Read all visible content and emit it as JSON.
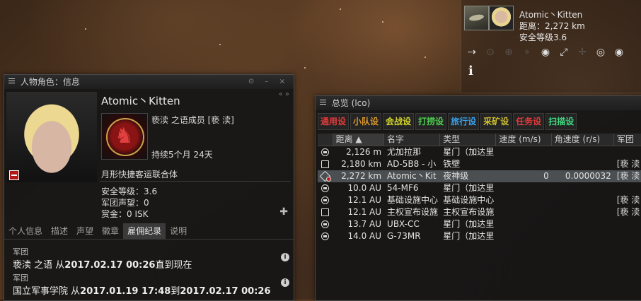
{
  "target": {
    "name": "Atomic丶Kitten",
    "distance": "距离：2,272 km",
    "security": "安全等级3.6",
    "info_glyph": "i",
    "action_icons": [
      "approach-icon",
      "orbit-icon",
      "keep-at-range-icon",
      "lock-icon",
      "warp-icon",
      "look-at-icon",
      "show-info-icon",
      "align-icon",
      "watch-icon"
    ]
  },
  "character_window": {
    "title": "人物角色：信息",
    "name": "Atomic丶Kitten",
    "corp_line": "亵渎 之语成员 [亵 渎]",
    "corp_duration": "持续5个月 24天",
    "alliance": "月形快捷客运联合体",
    "security": "安全等级：3.6",
    "faction_standing": "军团声望：0",
    "bounty": "赏金：0 ISK",
    "tabs": [
      "个人信息",
      "描述",
      "声望",
      "徽章",
      "雇佣纪录",
      "说明"
    ],
    "active_tab": "雇佣纪录",
    "history": [
      {
        "label": "军团",
        "corp": "亵渎 之语",
        "from_word": "从",
        "start": "2017.02.17 00:26",
        "to_word": "直到现在",
        "end": ""
      },
      {
        "label": "军团",
        "corp": "国立军事学院",
        "from_word": "从",
        "start": "2017.01.19 17:48",
        "to_word": "到",
        "end": "2017.02.17 00:26"
      }
    ]
  },
  "overview": {
    "title": "总览 (lco)",
    "presets": [
      {
        "label": "通用设",
        "color": "#e03a3a"
      },
      {
        "label": "小队设",
        "color": "#d8962a"
      },
      {
        "label": "会战设",
        "color": "#d6d62a"
      },
      {
        "label": "打捞设",
        "color": "#4fd04f"
      },
      {
        "label": "旅行设",
        "color": "#3aa0e8"
      },
      {
        "label": "采矿设",
        "color": "#d0c030"
      },
      {
        "label": "任务设",
        "color": "#e03a3a"
      },
      {
        "label": "扫描设",
        "color": "#40d880"
      }
    ],
    "columns": {
      "distance": "距离",
      "name": "名字",
      "type": "类型",
      "velocity": "速度 (m/s)",
      "angular": "角速度 (r/s)",
      "corp": "军团"
    },
    "rows": [
      {
        "icon": "stargate-icon",
        "distance": "2,126 m",
        "name": "尤加拉那",
        "type": "星门（加达里",
        "velocity": "",
        "angular": "",
        "corp": "",
        "selected": false
      },
      {
        "icon": "station-icon",
        "distance": "2,180 km",
        "name": "AD-5B8 - 小",
        "type": "铁壁",
        "velocity": "",
        "angular": "",
        "corp": "[亵 渎",
        "selected": false
      },
      {
        "icon": "ship-icon",
        "distance": "2,272 km",
        "name": "Atomic丶Kit",
        "type": "夜神级",
        "velocity": "0",
        "angular": "0.0000032",
        "corp": "[亵 渎",
        "selected": true
      },
      {
        "icon": "stargate-icon",
        "distance": "10.0 AU",
        "name": "54-MF6",
        "type": "星门（加达里",
        "velocity": "",
        "angular": "",
        "corp": "",
        "selected": false
      },
      {
        "icon": "structure-icon",
        "distance": "12.1 AU",
        "name": "基础设施中心",
        "type": "基础设施中心",
        "velocity": "",
        "angular": "",
        "corp": "[亵 渎",
        "selected": false
      },
      {
        "icon": "tcu-icon",
        "distance": "12.1 AU",
        "name": "主权宣布设施",
        "type": "主权宣布设施",
        "velocity": "",
        "angular": "",
        "corp": "[亵 渎",
        "selected": false
      },
      {
        "icon": "stargate-icon",
        "distance": "13.7 AU",
        "name": "UBX-CC",
        "type": "星门（加达里",
        "velocity": "",
        "angular": "",
        "corp": "",
        "selected": false
      },
      {
        "icon": "stargate-icon",
        "distance": "14.0 AU",
        "name": "G-73MR",
        "type": "星门（加达里",
        "velocity": "",
        "angular": "",
        "corp": "",
        "selected": false
      }
    ]
  }
}
